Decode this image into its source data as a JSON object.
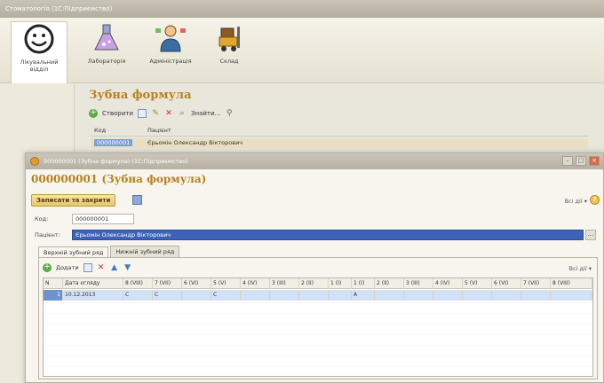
{
  "main_window": {
    "title": "Стоматологія (1С:Підприємство)"
  },
  "sections": [
    {
      "label": "Лікувальний відділ",
      "icon": "smiley-face-icon"
    },
    {
      "label": "Лабораторія",
      "icon": "flask-icon"
    },
    {
      "label": "Адміністрація",
      "icon": "administrator-icon"
    },
    {
      "label": "Склад",
      "icon": "forklift-icon"
    }
  ],
  "bg_form": {
    "title": "Зубна формула",
    "create_label": "Створити",
    "find_label": "Знайти...",
    "col_code": "Код",
    "col_patient": "Пацієнт",
    "row_code": "000000001",
    "row_patient": "Єрьомін Олександр Вікторович"
  },
  "dialog": {
    "window_title": "000000001 (Зубна формула) (1С:Підприємство)",
    "title": "000000001 (Зубна формула)",
    "save_close": "Записати та закрити",
    "all_actions": "Всі дії ▾",
    "code_label": "Код:",
    "code_value": "000000001",
    "patient_label": "Пацієнт:",
    "patient_value": "Єрьомін Олександр Вікторович",
    "tabs": [
      "Верхній зубний ряд",
      "Нижній зубний ряд"
    ],
    "add_label": "Додати",
    "grid_all_actions": "Всі дії ▾",
    "columns": [
      "N",
      "Дата огляду",
      "8 (VIII)",
      "7 (VII)",
      "6 (VI)",
      "5 (V)",
      "4 (IV)",
      "3 (III)",
      "2 (II)",
      "1 (I)",
      "1 (I)",
      "2 (II)",
      "3 (III)",
      "4 (IV)",
      "5 (V)",
      "6 (VI)",
      "7 (VII)",
      "8 (VIII)"
    ],
    "rows": [
      [
        "1",
        "10.12.2013",
        "С",
        "С",
        "",
        "С",
        "",
        "",
        "",
        "",
        "А",
        "",
        "",
        "",
        "",
        "",
        "",
        ""
      ]
    ]
  }
}
